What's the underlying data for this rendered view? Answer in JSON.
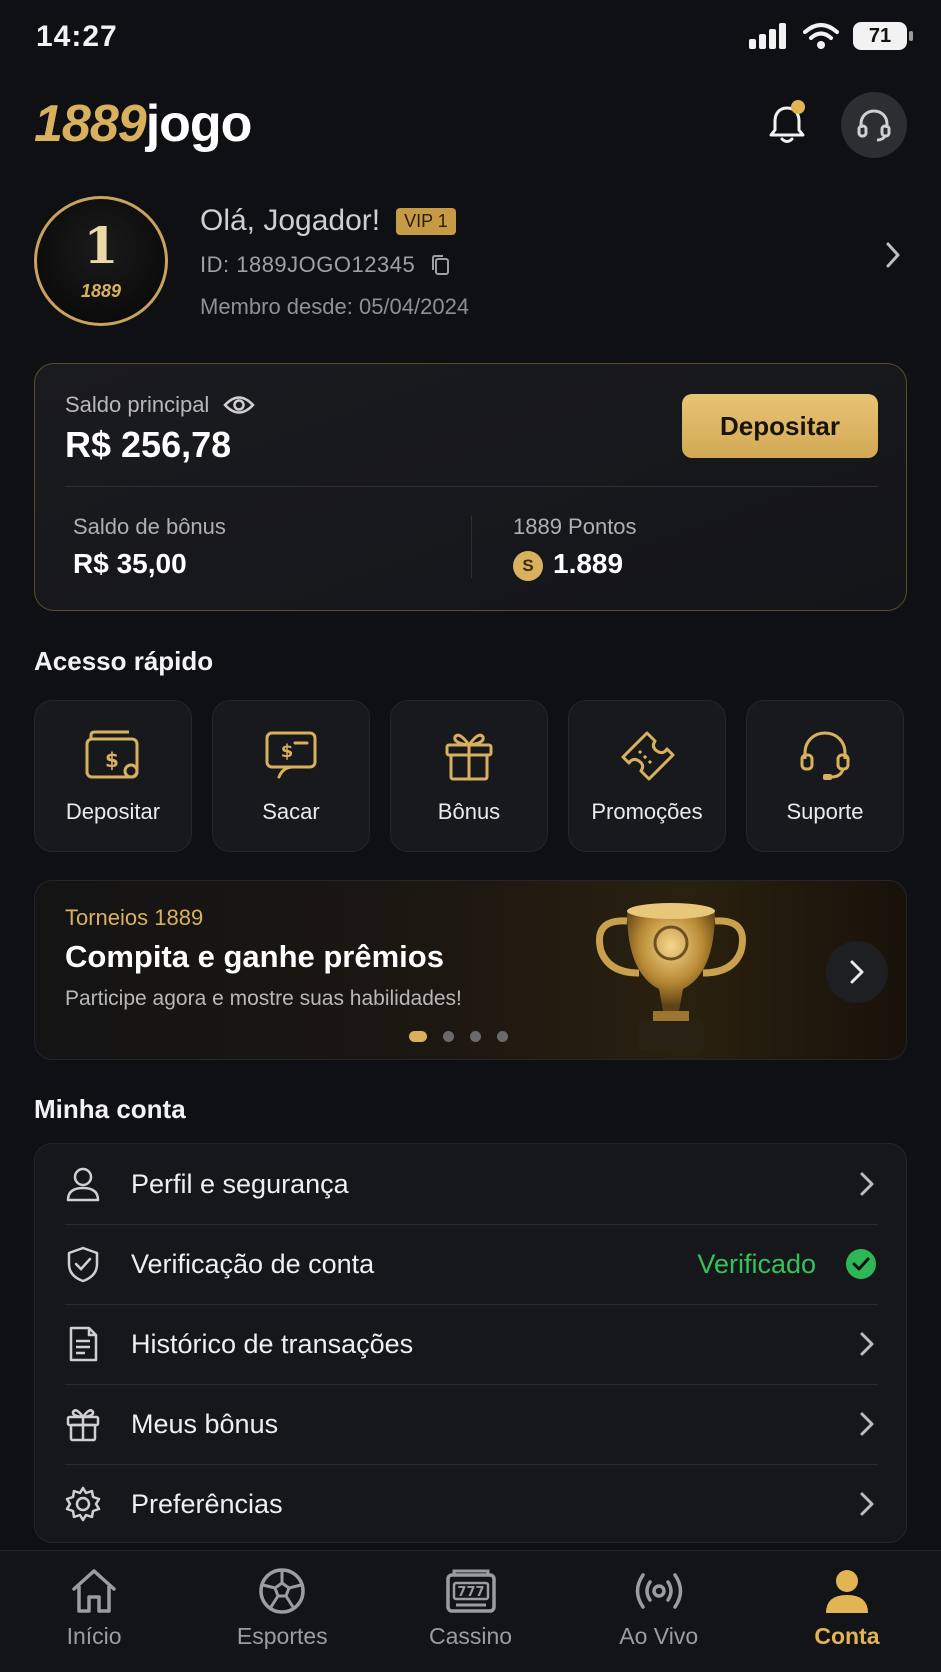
{
  "status_bar": {
    "time": "14:27",
    "battery": "71"
  },
  "header": {
    "logo_number": "1889",
    "logo_text": "jogo"
  },
  "profile": {
    "avatar_number": "1",
    "avatar_caption": "1889",
    "greeting": "Olá, Jogador!",
    "vip_badge": "VIP 1",
    "user_id": "ID: 1889JOGO12345",
    "member_since": "Membro desde: 05/04/2024"
  },
  "balance": {
    "main_label": "Saldo principal",
    "main_value": "R$ 256,78",
    "deposit_label": "Depositar",
    "bonus_label": "Saldo de bônus",
    "bonus_value": "R$ 35,00",
    "points_label": "1889 Pontos",
    "points_coin": "S",
    "points_value": "1.889"
  },
  "quick_access": {
    "title": "Acesso rápido",
    "items": [
      {
        "label": "Depositar",
        "icon": "wallet-icon"
      },
      {
        "label": "Sacar",
        "icon": "withdraw-icon"
      },
      {
        "label": "Bônus",
        "icon": "gift-icon"
      },
      {
        "label": "Promoções",
        "icon": "ticket-icon"
      },
      {
        "label": "Suporte",
        "icon": "headset-icon"
      }
    ]
  },
  "banner": {
    "tag": "Torneios 1889",
    "title": "Compita e ganhe prêmios",
    "subtitle": "Participe agora e mostre suas habilidades!",
    "slide_count": 4,
    "active_slide": 1
  },
  "account": {
    "title": "Minha conta",
    "items": [
      {
        "label": "Perfil e segurança",
        "icon": "user-icon"
      },
      {
        "label": "Verificação de conta",
        "icon": "shield-icon",
        "status": "Verificado"
      },
      {
        "label": "Histórico de transações",
        "icon": "document-icon"
      },
      {
        "label": "Meus bônus",
        "icon": "gift-icon"
      },
      {
        "label": "Preferências",
        "icon": "gear-icon"
      }
    ]
  },
  "bottom_nav": {
    "items": [
      {
        "label": "Início",
        "icon": "home-icon"
      },
      {
        "label": "Esportes",
        "icon": "soccer-ball-icon"
      },
      {
        "label": "Cassino",
        "icon": "slot-machine-icon"
      },
      {
        "label": "Ao Vivo",
        "icon": "live-broadcast-icon"
      },
      {
        "label": "Conta",
        "icon": "account-icon",
        "active": true
      }
    ]
  },
  "colors": {
    "accent": "#d9b15e",
    "background": "#0e1013",
    "success": "#38c15a"
  }
}
